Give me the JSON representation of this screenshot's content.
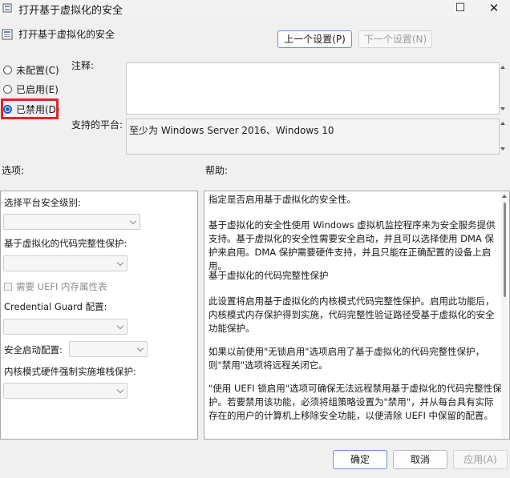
{
  "window": {
    "title": "打开基于虚拟化的安全",
    "minimize": "—",
    "maximize": "☐",
    "close": "✕"
  },
  "header": {
    "title": "打开基于虚拟化的安全",
    "prev_button": "上一个设置(P)",
    "next_button": "下一个设置(N)"
  },
  "state": {
    "options": [
      {
        "label": "未配置(C)",
        "checked": false
      },
      {
        "label": "已启用(E)",
        "checked": false
      },
      {
        "label": "已禁用(D)",
        "checked": true
      }
    ],
    "comment_label": "注释:",
    "comment_value": "",
    "platform_label": "支持的平台:",
    "platform_value": "至少为 Windows Server 2016、Windows 10"
  },
  "options_panel": {
    "title": "选项:",
    "platform_security_label": "选择平台安全级别:",
    "code_integrity_label": "基于虚拟化的代码完整性保护:",
    "uefi_mem_label": "需要 UEFI 内存属性表",
    "credential_guard_label": "Credential Guard 配置:",
    "secure_launch_label": "安全启动配置:",
    "kernel_stack_label": "内核模式硬件强制实施堆栈保护:"
  },
  "help_panel": {
    "title": "帮助:",
    "paragraphs": [
      "指定是否启用基于虚拟化的安全性。",
      "基于虚拟化的安全性使用 Windows 虚拟机监控程序来为安全服务提供支持。基于虚拟化的安全性需要安全启动，并且可以选择使用 DMA 保护来启用。DMA 保护需要硬件支持，并且只能在正确配置的设备上启用。",
      "基于虚拟化的代码完整性保护",
      "此设置将启用基于虚拟化的内核模式代码完整性保护。启用此功能后，内核模式内存保护得到实施，代码完整性验证路径受基于虚拟化的安全功能保护。",
      "如果以前使用\"无锁启用\"选项启用了基于虚拟化的代码完整性保护，则\"禁用\"选项将远程关闭它。",
      "\"使用 UEFI 锁启用\"选项可确保无法远程禁用基于虚拟化的代码完整性保护。若要禁用该功能，必须将组策略设置为\"禁用\"，并从每台具有实际存在的用户的计算机上移除安全功能，以便清除 UEFI 中保留的配置。"
    ]
  },
  "footer": {
    "ok": "确定",
    "cancel": "取消",
    "apply": "应用(A)"
  }
}
